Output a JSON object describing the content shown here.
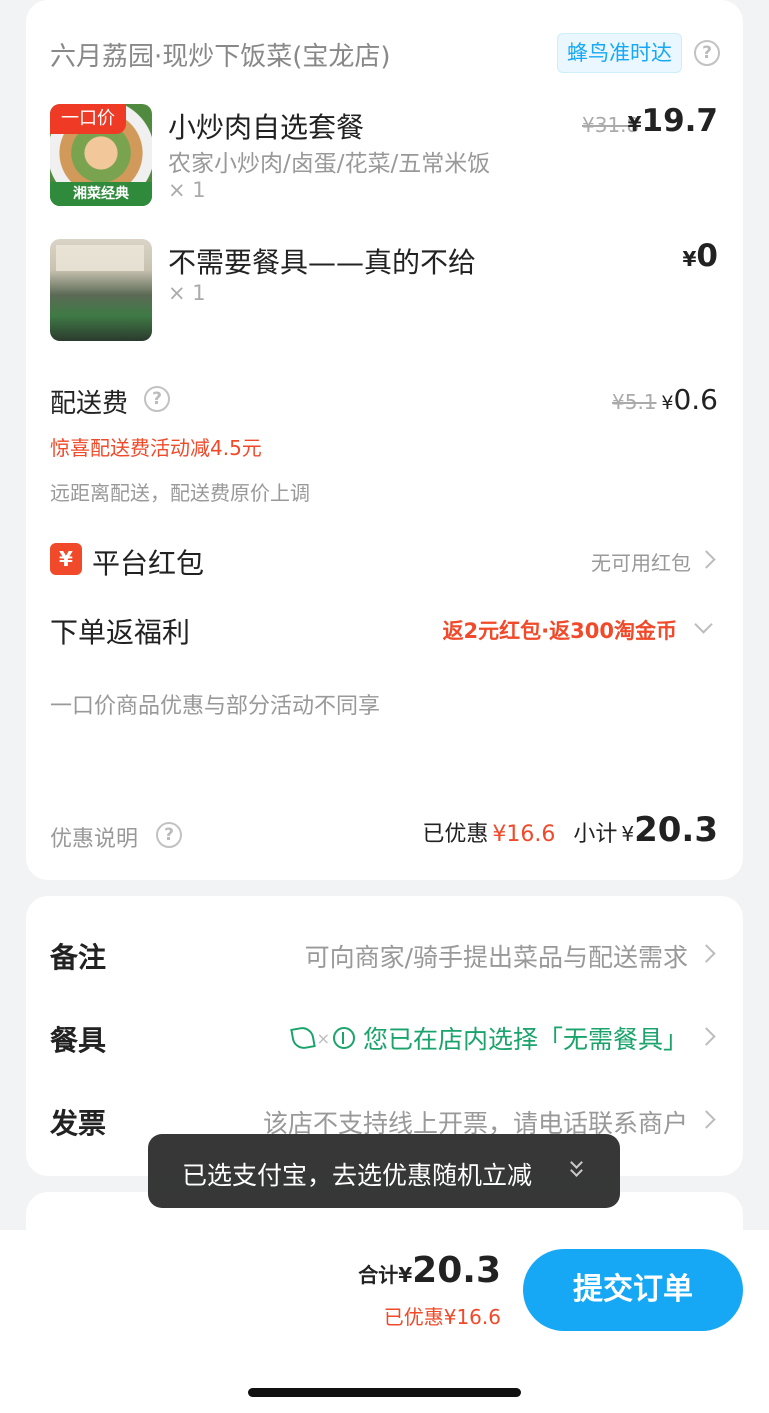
{
  "shop": {
    "name": "六月荔园·现炒下饭菜(宝龙店)",
    "delivery_badge": "蜂鸟准时达"
  },
  "items": [
    {
      "tag": "一口价",
      "image_caption": "湘菜经典",
      "name": "小炒肉自选套餐",
      "desc": "农家小炒肉/卤蛋/花菜/五常米饭",
      "qty": "× 1",
      "original_price": "¥31.8",
      "currency": "¥",
      "price": "19.7"
    },
    {
      "name": "不需要餐具——真的不给",
      "qty": "× 1",
      "currency": "¥",
      "price": "0"
    }
  ],
  "delivery_fee": {
    "label": "配送费",
    "original": "¥5.1",
    "currency": "¥",
    "price": "0.6",
    "promo": "惊喜配送费活动减4.5元",
    "note": "远距离配送，配送费原价上调"
  },
  "red_packet": {
    "icon_char": "¥",
    "label": "平台红包",
    "value": "无可用红包"
  },
  "rewards": {
    "label": "下单返福利",
    "value": "返2元红包·返300淘金币"
  },
  "notice": "一口价商品优惠与部分活动不同享",
  "summary": {
    "discount_label": "优惠说明",
    "saved_label": "已优惠",
    "saved_value": "¥16.6",
    "subtotal_label": "小计",
    "currency": "¥",
    "subtotal_value": "20.3"
  },
  "options": {
    "remark_label": "备注",
    "remark_value": "可向商家/骑手提出菜品与配送需求",
    "utensils_label": "餐具",
    "utensils_x": "×",
    "utensils_value": "您已在店内选择「无需餐具」",
    "invoice_label": "发票",
    "invoice_value": "该店不支持线上开票，请电话联系商户"
  },
  "toast": "已选支付宝，去选优惠随机立减",
  "footer": {
    "total_label": "合计",
    "currency": "¥",
    "total_value": "20.3",
    "saved_text": "已优惠¥16.6",
    "submit_label": "提交订单"
  },
  "colors": {
    "accent_red": "#f04a2a",
    "submit_blue": "#17a8f5",
    "eco_green": "#1aa36b"
  }
}
